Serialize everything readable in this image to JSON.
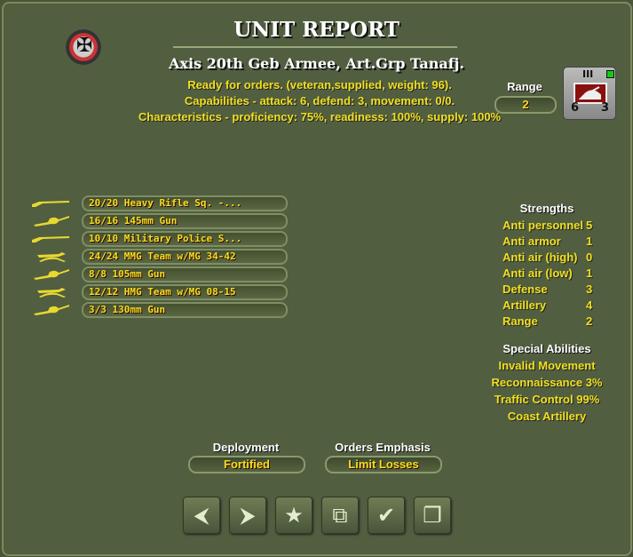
{
  "header": {
    "title": "UNIT REPORT",
    "unit_name": "Axis 20th Geb Armee, Art.Grp Tanafj.",
    "status": "Ready for orders. (veteran,supplied, weight: 96).",
    "capabilities": "Capabilities - attack: 6, defend: 3, movement: 0/0.",
    "characteristics": "Characteristics - proficiency: 75%, readiness: 100%, supply: 100%"
  },
  "range": {
    "label": "Range",
    "value": "2"
  },
  "counter": {
    "size": "III",
    "attack": "6",
    "defend": "3"
  },
  "units": [
    {
      "text": "20/20 Heavy Rifle Sq. -...",
      "icon": "rifle-icon"
    },
    {
      "text": "16/16 145mm Gun",
      "icon": "gun-icon"
    },
    {
      "text": "10/10 Military Police S...",
      "icon": "rifle-icon"
    },
    {
      "text": "24/24 MMG Team w/MG 34-42",
      "icon": "machine-gun-icon"
    },
    {
      "text": "8/8 105mm Gun",
      "icon": "gun-icon"
    },
    {
      "text": "12/12 HMG Team w/MG 08-15",
      "icon": "machine-gun-icon"
    },
    {
      "text": "3/3 130mm Gun",
      "icon": "gun-icon"
    }
  ],
  "strengths": {
    "title": "Strengths",
    "rows": [
      {
        "label": "Anti personnel",
        "value": "5"
      },
      {
        "label": "Anti armor",
        "value": "1"
      },
      {
        "label": "Anti air (high)",
        "value": "0"
      },
      {
        "label": "Anti air (low)",
        "value": "1"
      },
      {
        "label": "Defense",
        "value": "3"
      },
      {
        "label": "Artillery",
        "value": "4"
      },
      {
        "label": "Range",
        "value": "2"
      }
    ]
  },
  "abilities": {
    "title": "Special Abilities",
    "items": [
      "Invalid Movement",
      "Reconnaissance 3%",
      "Traffic Control  99%",
      "Coast Artillery"
    ]
  },
  "deployment": {
    "label": "Deployment",
    "value": "Fortified"
  },
  "orders": {
    "label": "Orders Emphasis",
    "value": "Limit Losses"
  },
  "colors": {
    "text": "#f0e020",
    "bg": "#515e40"
  }
}
